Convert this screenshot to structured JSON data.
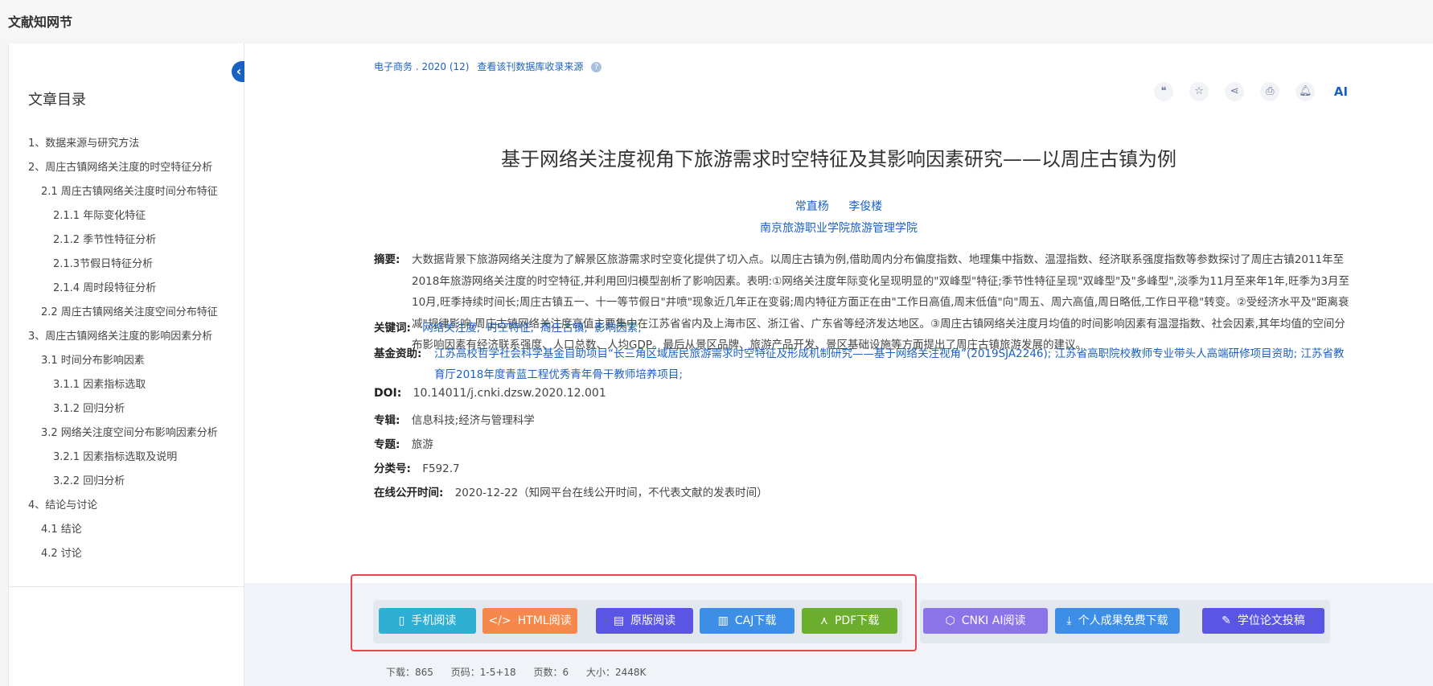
{
  "app": {
    "brand": "文献知网节"
  },
  "toc": {
    "title": "文章目录",
    "items": [
      {
        "label": "1、数据来源与研究方法",
        "level": 1
      },
      {
        "label": "2、周庄古镇网络关注度的时空特征分析",
        "level": 1
      },
      {
        "label": "2.1 周庄古镇网络关注度时间分布特征",
        "level": 2
      },
      {
        "label": "2.1.1 年际变化特征",
        "level": 3
      },
      {
        "label": "2.1.2 季节性特征分析",
        "level": 3
      },
      {
        "label": "2.1.3节假日特征分析",
        "level": 3
      },
      {
        "label": "2.1.4 周时段特征分析",
        "level": 3
      },
      {
        "label": "2.2 周庄古镇网络关注度空间分布特征",
        "level": 2
      },
      {
        "label": "3、周庄古镇网络关注度的影响因素分析",
        "level": 1
      },
      {
        "label": "3.1 时间分布影响因素",
        "level": 2
      },
      {
        "label": "3.1.1 因素指标选取",
        "level": 3
      },
      {
        "label": "3.1.2 回归分析",
        "level": 3
      },
      {
        "label": "3.2 网络关注度空间分布影响因素分析",
        "level": 2
      },
      {
        "label": "3.2.1 因素指标选取及说明",
        "level": 3
      },
      {
        "label": "3.2.2 回归分析",
        "level": 3
      },
      {
        "label": "4、结论与讨论",
        "level": 1
      },
      {
        "label": "4.1 结论",
        "level": 2
      },
      {
        "label": "4.2 讨论",
        "level": 2
      }
    ]
  },
  "source": {
    "journal": "电子商务",
    "sep": ".",
    "issue": "2020 (12)",
    "link": "查看该刊数据库收录来源",
    "help": "?"
  },
  "tools": {
    "ai_label": "AI"
  },
  "article": {
    "title": "基于网络关注度视角下旅游需求时空特征及其影响因素研究——以周庄古镇为例",
    "authors": [
      "常直杨",
      "李俊楼"
    ],
    "institution": "南京旅游职业学院旅游管理学院",
    "abstract_label": "摘要:",
    "abstract": "大数据背景下旅游网络关注度为了解景区旅游需求时空变化提供了切入点。以周庄古镇为例,借助周内分布偏度指数、地理集中指数、温湿指数、经济联系强度指数等参数探讨了周庄古镇2011年至2018年旅游网络关注度的时空特征,并利用回归模型剖析了影响因素。表明:①网络关注度年际变化呈现明显的\"双峰型\"特征;季节性特征呈现\"双峰型\"及\"多峰型\",淡季为11月至来年1年,旺季为3月至10月,旺季持续时间长;周庄古镇五一、十一等节假日\"井喷\"现象近几年正在变弱;周内特征方面正在由\"工作日高值,周末低值\"向\"周五、周六高值,周日略低,工作日平稳\"转变。②受经济水平及\"距离衰减\"规律影响,周庄古镇网络关注度高值主要集中在江苏省省内及上海市区、浙江省、广东省等经济发达地区。③周庄古镇网络关注度月均值的时间影响因素有温湿指数、社会因素,其年均值的空间分布影响因素有经济联系强度、人口总数、人均GDP。最后从景区品牌、旅游产品开发、景区基础设施等方面提出了周庄古镇旅游发展的建议。",
    "keywords_label": "关键词:",
    "keywords": [
      "网络关注度;",
      "时空特征;",
      "周庄古镇;",
      "影响因素;"
    ],
    "fund_label": "基金资助:",
    "fund": "江苏高校哲学社会科学基金自助项目“长三角区域居民旅游需求时空特征及形成机制研究——基于网络关注视角”(2019SJA2246); 江苏省高职院校教师专业带头人高端研修项目资助; 江苏省教育厅2018年度青蓝工程优秀青年骨干教师培养项目;",
    "doi_label": "DOI:",
    "doi": "10.14011/j.cnki.dzsw.2020.12.001",
    "series_label": "专辑:",
    "series": "信息科技;经济与管理科学",
    "topic_label": "专题:",
    "topic": "旅游",
    "class_label": "分类号:",
    "class_no": "F592.7",
    "pub_label": "在线公开时间:",
    "pub_time": "2020-12-22（知网平台在线公开时间，不代表文献的发表时间）"
  },
  "downloads": {
    "mobile": "手机阅读",
    "html": "HTML阅读",
    "original": "原版阅读",
    "caj": "CAJ下载",
    "pdf": "PDF下载",
    "cnki_ai": "CNKI AI阅读",
    "personal": "个人成果免费下载",
    "thesis": "学位论文投稿"
  },
  "stats": {
    "downloads": "下载：865",
    "pages": "页码：1-5+18",
    "page_count": "页数：6",
    "size": "大小：2448K"
  },
  "colors": {
    "link": "#1a61c4",
    "mobile": "#2eb0d4",
    "html": "#f5884a",
    "original": "#5b55e6",
    "caj": "#3d8ee6",
    "pdf": "#6bad2d",
    "cnki_ai": "#8b74e8",
    "personal": "#3d8ee6",
    "thesis": "#5b55e6",
    "highlight": "#e8464e"
  }
}
